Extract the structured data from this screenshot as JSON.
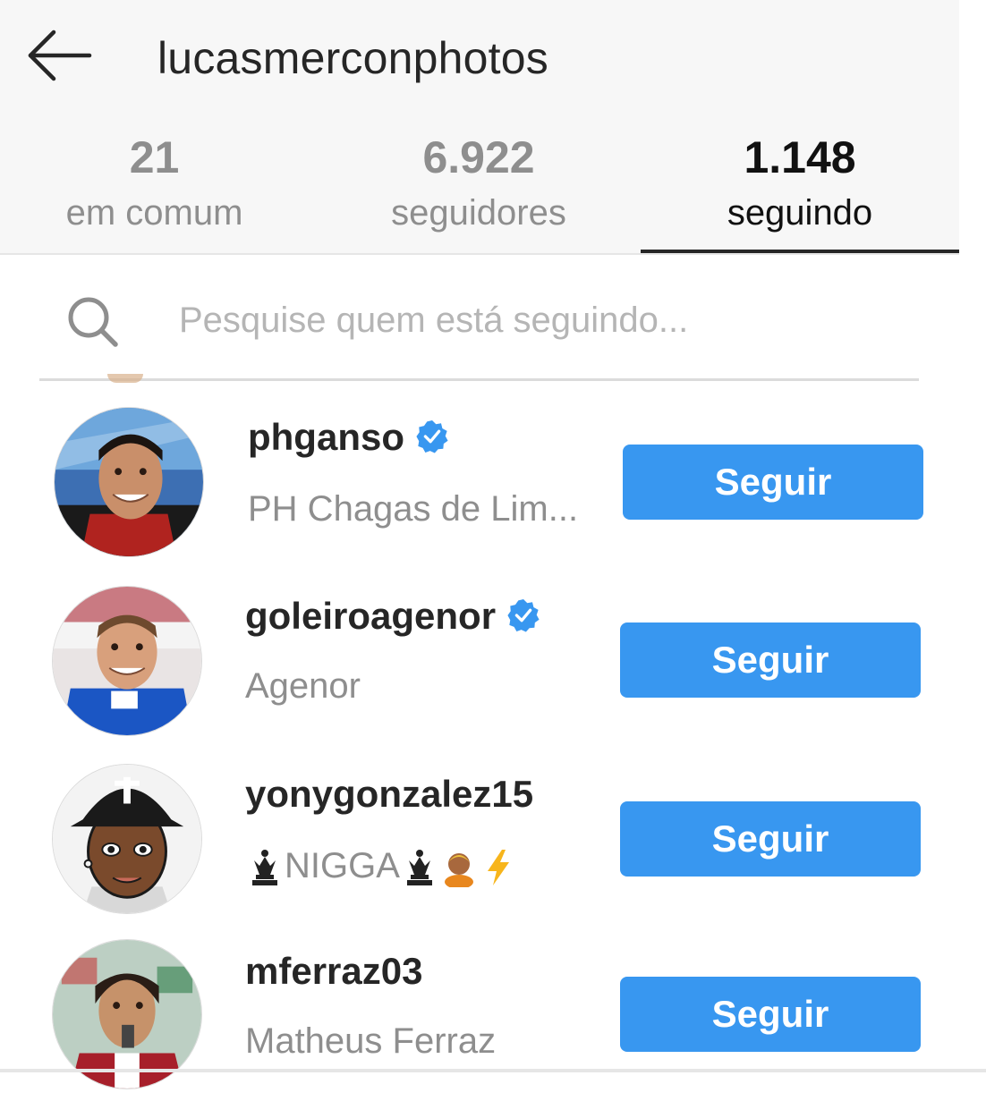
{
  "header": {
    "title": "lucasmerconphotos"
  },
  "tabs": [
    {
      "count": "21",
      "label": "em comum"
    },
    {
      "count": "6.922",
      "label": "seguidores"
    },
    {
      "count": "1.148",
      "label": "seguindo"
    }
  ],
  "search": {
    "placeholder": "Pesquise quem está seguindo..."
  },
  "users": [
    {
      "username": "phganso",
      "full_name": "PH Chagas de Lim...",
      "button": "Seguir"
    },
    {
      "username": "goleiroagenor",
      "full_name": "Agenor",
      "button": "Seguir"
    },
    {
      "username": "yonygonzalez15",
      "full_name": "NIGGA",
      "button": "Seguir"
    },
    {
      "username": "mferraz03",
      "full_name": "Matheus Ferraz",
      "button": "Seguir"
    }
  ],
  "colors": {
    "accent": "#3897f0",
    "verified": "#3897f0",
    "muted_text": "#8e8e8e"
  }
}
